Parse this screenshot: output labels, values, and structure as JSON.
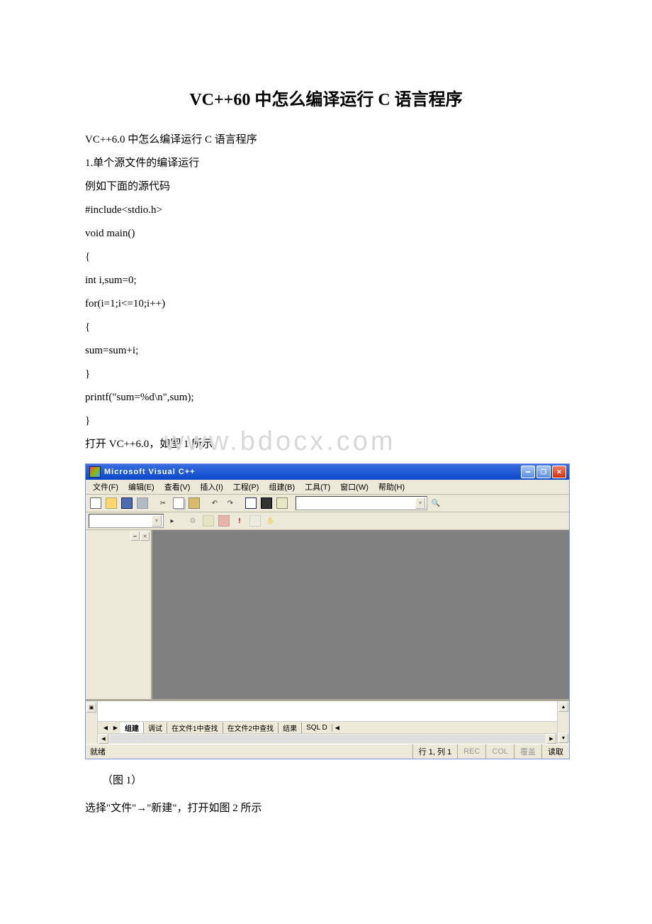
{
  "doc": {
    "title": "VC++60 中怎么编译运行 C 语言程序",
    "lines": [
      "VC++6.0 中怎么编译运行 C 语言程序",
      "1.单个源文件的编译运行",
      "例如下面的源代码",
      "#include<stdio.h>",
      "void main()",
      "{",
      " int i,sum=0;",
      " for(i=1;i<=10;i++)",
      " {",
      " sum=sum+i;",
      " }",
      " printf(\"sum=%d\\n\",sum);",
      "}",
      "打开 VC++6.0，如图 1 所示"
    ],
    "watermark": "www.bdocx.com",
    "fig_caption": "（图 1）",
    "post_text": "选择\"文件\"→\"新建\"，打开如图 2 所示"
  },
  "vc": {
    "title": "Microsoft Visual C++",
    "menu": [
      "文件(F)",
      "编辑(E)",
      "查看(V)",
      "插入(I)",
      "工程(P)",
      "组建(B)",
      "工具(T)",
      "窗口(W)",
      "帮助(H)"
    ],
    "tabs": {
      "nav_left": "◀",
      "nav_right": "▶",
      "items": [
        "组建",
        "调试",
        "在文件1中查找",
        "在文件2中查找",
        "结果",
        "SQL D"
      ]
    },
    "status": {
      "ready": "就绪",
      "pos": "行 1, 列 1",
      "rec": "REC",
      "col": "COL",
      "ovr": "覆盖",
      "read": "读取"
    }
  }
}
